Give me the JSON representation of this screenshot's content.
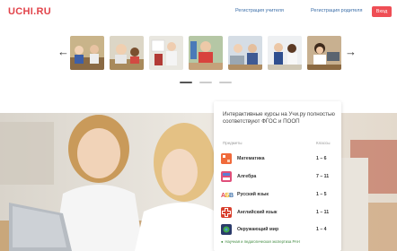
{
  "header": {
    "logo_main": "UCHI",
    "logo_dot": ".RU",
    "nav": [
      {
        "label": "Регистрация учителя"
      },
      {
        "label": "Регистрация родителя"
      }
    ],
    "login_label": "Вход"
  },
  "gallery": {
    "prev_icon": "arrow-left-icon",
    "next_icon": "arrow-right-icon",
    "thumb_count": 7,
    "active_page": 1,
    "page_count": 3
  },
  "card": {
    "title": "Интерактивные курсы на Учи.ру полностью соответствуют ФГОС и ПООП",
    "col_subjects": "Предметы",
    "col_grades": "Классы",
    "subjects": [
      {
        "name": "Математика",
        "grade": "1 – 6",
        "icon": "math-icon",
        "color": "#f06a3b"
      },
      {
        "name": "Алгебра",
        "grade": "7 – 11",
        "icon": "algebra-icon",
        "color": "#e04f7a"
      },
      {
        "name": "Русский язык",
        "grade": "1 – 5",
        "icon": "russian-abc-icon",
        "color": "#f0b72b"
      },
      {
        "name": "Английский язык",
        "grade": "1 – 11",
        "icon": "english-icon",
        "color": "#d8402e"
      },
      {
        "name": "Окружающий мир",
        "grade": "1 – 4",
        "icon": "world-icon",
        "color": "#2a3a6a"
      }
    ],
    "footer_link": "Научная и педагогическая экспертиза РАН"
  },
  "colors": {
    "brand_red": "#e2434a",
    "link_blue": "#3b6ea8",
    "login_bg": "#ef4e55"
  }
}
